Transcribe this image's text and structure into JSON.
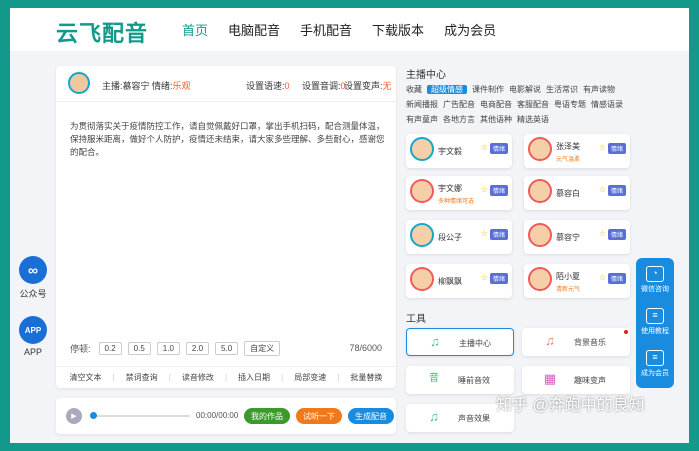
{
  "app": {
    "logo": "云飞配音"
  },
  "nav": [
    {
      "label": "首页"
    },
    {
      "label": "电脑配音"
    },
    {
      "label": "手机配音"
    },
    {
      "label": "下载版本"
    },
    {
      "label": "成为会员"
    }
  ],
  "left_float": {
    "wechat_label": "公众号",
    "app_label": "APP",
    "app_icon_text": "APP"
  },
  "editor": {
    "anchor": "主播:慕容宁",
    "emotion_label": "情绪:",
    "emotion_value": "乐观",
    "speed_label": "设置语速:",
    "speed_value": "0",
    "volume_label": "设置音调:",
    "volume_value": "0",
    "pitch_label": "设置变声:",
    "pitch_value": "无",
    "text": "为贯彻落实关于疫情防控工作，请自觉佩戴好口罩，掌出手机扫码，配合测量体温，保持服米距离，做好个人防护，疫情还未结束，请大家多些理解、多些耐心，感谢您的配合。",
    "pause_label": "停顿:",
    "pause_options": [
      "0.2",
      "0.5",
      "1.0",
      "2.0",
      "5.0",
      "自定义"
    ],
    "char_count": "78/6000",
    "tools": [
      "清空文本",
      "禁词查询",
      "读音修改",
      "插入日期",
      "局部变速",
      "批量替换"
    ]
  },
  "player": {
    "time": "00:00/00:00",
    "works_label": "我的作品",
    "try_label": "试听一下",
    "generate_label": "生成配音",
    "progress": 0
  },
  "anchor_center": {
    "title": "主播中心",
    "category_lines": [
      [
        "收藏",
        "超级情感",
        "课件制作",
        "电影解说",
        "生活常识",
        "有声读物"
      ],
      [
        "新闻播报",
        "广告配音",
        "电商配音",
        "客服配音",
        "粤语专题",
        "情感语录"
      ],
      [
        "有声童声",
        "各地方言",
        "其他语种",
        "精选英语"
      ]
    ],
    "active_category": "超级情感",
    "voices": [
      {
        "name": "宇文毅",
        "sub": "",
        "tag": "情绪"
      },
      {
        "name": "张泽美",
        "sub": "元气温柔",
        "tag": "情绪"
      },
      {
        "name": "宇文娜",
        "sub": "多种情绪可选",
        "tag": "情绪"
      },
      {
        "name": "慕容白",
        "sub": "",
        "tag": "情绪"
      },
      {
        "name": "段公子",
        "sub": "",
        "tag": "情绪"
      },
      {
        "name": "慕容宁",
        "sub": "",
        "tag": "情绪"
      },
      {
        "name": "柳飘飘",
        "sub": "",
        "tag": "情绪"
      },
      {
        "name": "陌小夏",
        "sub": "清新元气",
        "tag": "情绪"
      }
    ]
  },
  "tools_section": {
    "title": "工具",
    "items": [
      {
        "label": "主播中心",
        "icon": "♫",
        "selected": true
      },
      {
        "label": "背景音乐",
        "icon": "♫",
        "selected": false
      },
      {
        "label": "睡前音效",
        "icon": "音",
        "selected": false
      },
      {
        "label": "趣味变声",
        "icon": "▦",
        "selected": false
      },
      {
        "label": "声音效果",
        "icon": "♫",
        "selected": false
      }
    ]
  },
  "right_float": {
    "items": [
      "微信咨询",
      "使用教程",
      "成为会员"
    ]
  },
  "watermark": "知乎 @奔跑中的良知",
  "colors": {
    "brand": "#12998a",
    "accent": "#1a8ce0",
    "orange": "#f07a1a",
    "green": "#3c9a2a"
  }
}
